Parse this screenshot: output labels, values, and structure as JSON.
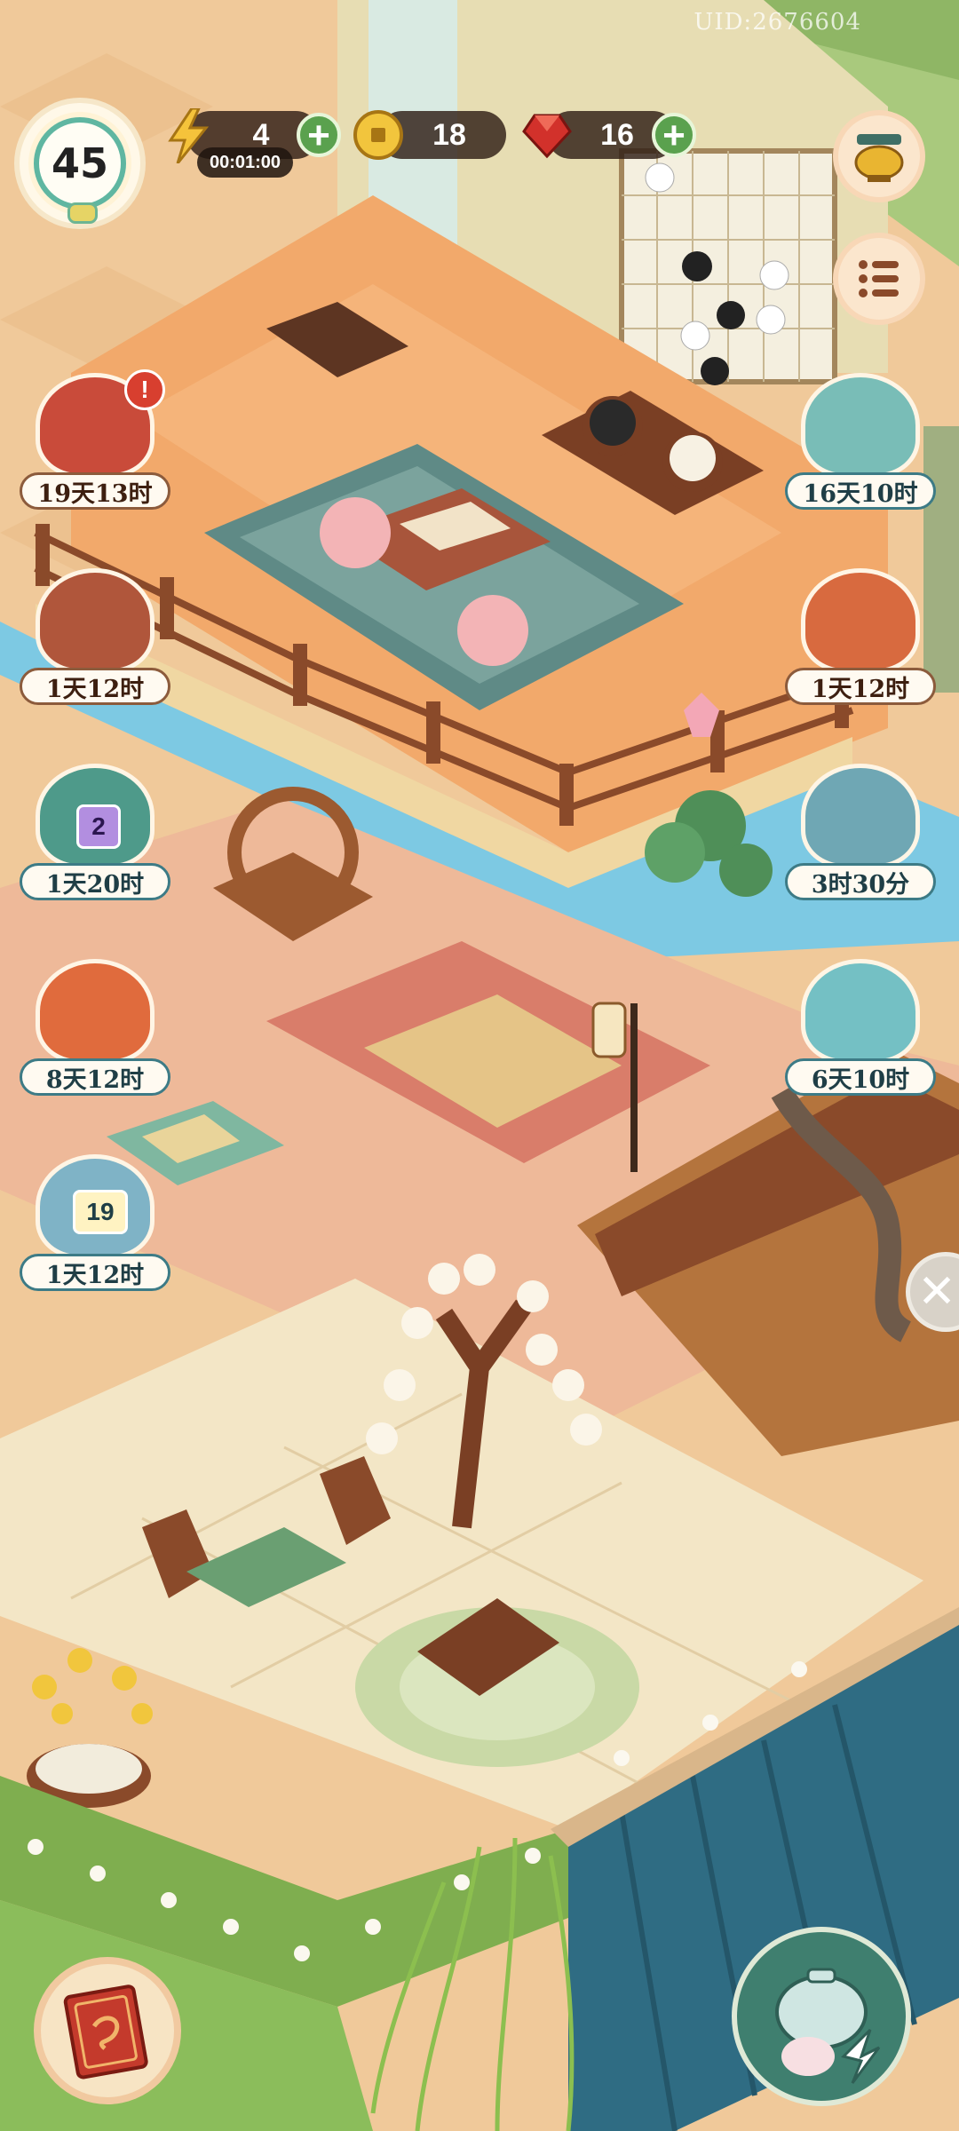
{
  "uid": "UID:2676604",
  "level": "45",
  "currencies": {
    "energy": {
      "value": "4",
      "timer": "00:01:00",
      "icon": "lightning-icon"
    },
    "coins": {
      "value": "18",
      "icon": "coin-icon"
    },
    "gems": {
      "value": "16",
      "icon": "ruby-icon"
    }
  },
  "side_buttons": {
    "shop": {
      "icon": "golden-cauldron-icon"
    },
    "menu": {
      "icon": "list-menu-icon"
    }
  },
  "events_left": [
    {
      "label": "19天13时",
      "icon": "maple-book-icon",
      "alert": "!"
    },
    {
      "label": "1天12时",
      "icon": "teapot-icon"
    },
    {
      "label": "1天20时",
      "icon": "treasure-gate-icon",
      "badge": "2"
    },
    {
      "label": "8天12时",
      "icon": "lady-portrait-icon"
    },
    {
      "label": "1天12时",
      "icon": "lotus-icon",
      "badge": "19"
    }
  ],
  "events_right": [
    {
      "label": "16天10时",
      "icon": "bath-cat-icon"
    },
    {
      "label": "1天12时",
      "icon": "fan-cat-icon"
    },
    {
      "label": "3时30分",
      "icon": "snow-fish-icon"
    },
    {
      "label": "6天10时",
      "icon": "gift-cat-icon"
    }
  ],
  "bottom_buttons": {
    "book": {
      "icon": "red-book-icon"
    },
    "tea": {
      "icon": "teapot-rabbit-icon"
    }
  },
  "colors": {
    "floor": "#f3c68e",
    "water": "#7dc9e3",
    "roof_green": "#a9c97d",
    "roof_blue": "#2f6c83",
    "wood": "#8a4a2a",
    "accent_green": "#5aa14e"
  }
}
